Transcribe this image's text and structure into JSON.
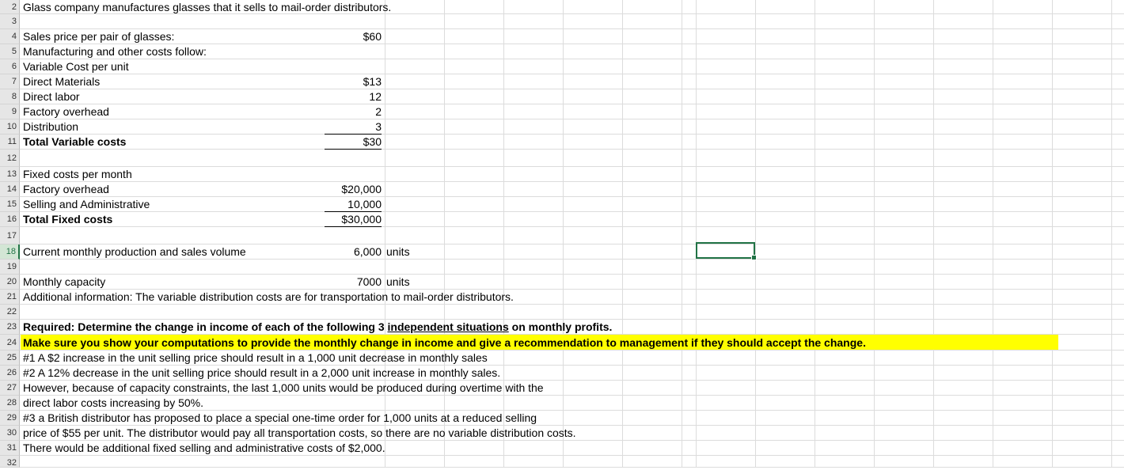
{
  "rows": [
    "2",
    "3",
    "4",
    "5",
    "6",
    "7",
    "8",
    "9",
    "10",
    "11",
    "12",
    "13",
    "14",
    "15",
    "16",
    "17",
    "18",
    "19",
    "20",
    "21",
    "22",
    "23",
    "24",
    "25",
    "26",
    "27",
    "28",
    "29",
    "30",
    "31",
    "32"
  ],
  "selected_row": "18",
  "cells": {
    "intro": "Glass company manufactures glasses that it sells to mail-order distributors.",
    "sales_price_label": "Sales price per pair of glasses:",
    "sales_price_value": "$60",
    "mfg_costs_label": "Manufacturing and other costs follow:",
    "var_cost_header": "Variable Cost per unit",
    "direct_materials_label": "Direct Materials",
    "direct_materials_value": "$13",
    "direct_labor_label": "Direct labor",
    "direct_labor_value": "12",
    "factory_overhead_label": "Factory overhead",
    "factory_overhead_value": "2",
    "distribution_label": "Distribution",
    "distribution_value": "3",
    "total_var_label": "Total Variable costs",
    "total_var_value": "$30",
    "fixed_header": "Fixed costs per month",
    "fixed_overhead_label": "Factory overhead",
    "fixed_overhead_value": "$20,000",
    "sga_label": "Selling and Administrative",
    "sga_value": "10,000",
    "total_fixed_label": "Total Fixed costs",
    "total_fixed_value": "$30,000",
    "volume_label": "Current monthly production and sales volume",
    "volume_value": "6,000",
    "volume_unit": "units",
    "capacity_label": "Monthly capacity",
    "capacity_value": "7000",
    "capacity_unit": "units",
    "additional_info": "Additional information:  The variable distribution costs are for transportation to mail-order distributors.",
    "required_prefix": "Required:  Determine the change in income of each of the following 3 ",
    "required_underlined": "independent situations",
    "required_suffix": " on monthly profits.",
    "make_sure": "Make sure you show your computations to provide the monthly change in income and give a recommendation to management if they should accept the change.",
    "line25": "#1 A $2 increase in the unit selling price should result in a 1,000 unit decrease in monthly sales",
    "line26": "#2 A  12% decrease in the unit selling price should result in a 2,000 unit increase in monthly sales.",
    "line27": "However, because of capacity constraints, the last 1,000 units would be produced during overtime with the",
    "line28": "direct labor costs increasing by 50%.",
    "line29": "#3 a British distributor has proposed to place a special one-time order for 1,000 units at a reduced selling",
    "line30": "price of $55 per unit.  The distributor would pay all transportation costs, so there are no variable distribution costs.",
    "line31": "There would be additional fixed selling and administrative costs of $2,000."
  },
  "colors": {
    "highlight": "#ffff00",
    "selection": "#217346"
  }
}
